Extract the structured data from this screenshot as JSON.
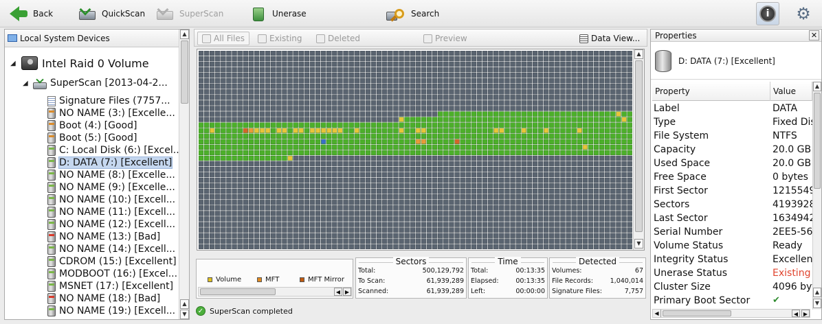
{
  "toolbar": {
    "back": "Back",
    "quickscan": "QuickScan",
    "superscan": "SuperScan",
    "unerase": "Unerase",
    "search": "Search"
  },
  "left_panel": {
    "title": "Local System Devices",
    "device": "Intel   Raid 0 Volume",
    "scan": "SuperScan [2013-04-2...",
    "items": [
      {
        "label": "Signature Files (7757...",
        "kind": "sig",
        "color": "#7ab648"
      },
      {
        "label": "NO NAME (3:) [Excelle...",
        "kind": "vol",
        "color": "#d98b2b"
      },
      {
        "label": "Boot (4:) [Good]",
        "kind": "vol",
        "color": "#d98b2b"
      },
      {
        "label": "Boot (5:) [Good]",
        "kind": "vol",
        "color": "#d98b2b"
      },
      {
        "label": "C: Local Disk (6:) [Excel...",
        "kind": "vol",
        "color": "#7ab648"
      },
      {
        "label": "D: DATA (7:) [Excellent]",
        "kind": "vol",
        "color": "#7ab648",
        "selected": true
      },
      {
        "label": "NO NAME (8:) [Excelle...",
        "kind": "vol",
        "color": "#7ab648"
      },
      {
        "label": "NO NAME (9:) [Excelle...",
        "kind": "vol",
        "color": "#7ab648"
      },
      {
        "label": "NO NAME (10:) [Excell...",
        "kind": "vol",
        "color": "#7ab648"
      },
      {
        "label": "NO NAME (11:) [Excell...",
        "kind": "vol",
        "color": "#7ab648"
      },
      {
        "label": "NO NAME (12:) [Excell...",
        "kind": "vol",
        "color": "#7ab648"
      },
      {
        "label": "NO NAME (13:) [Bad]",
        "kind": "vol",
        "color": "#d93a2b"
      },
      {
        "label": "NO NAME (14:) [Excell...",
        "kind": "vol",
        "color": "#7ab648"
      },
      {
        "label": "CDROM (15:) [Excellent]",
        "kind": "vol",
        "color": "#7ab648"
      },
      {
        "label": "MODBOOT (16:) [Excel...",
        "kind": "vol",
        "color": "#7ab648"
      },
      {
        "label": "MSNET (17:) [Excellent]",
        "kind": "vol",
        "color": "#7ab648"
      },
      {
        "label": "NO NAME (18:) [Bad]",
        "kind": "vol",
        "color": "#d93a2b"
      },
      {
        "label": "NO NAME (19:) [Excell...",
        "kind": "vol",
        "color": "#7ab648"
      }
    ]
  },
  "center": {
    "tabs": {
      "all_files": "All Files",
      "existing": "Existing",
      "deleted": "Deleted",
      "preview": "Preview",
      "data_view": "Data View..."
    },
    "legend": {
      "volume": "Volume",
      "mft": "MFT",
      "mft_mirror": "MFT Mirror",
      "colors": {
        "volume": "#e0c020",
        "mft": "#e08a20",
        "mft_mirror": "#c05a10"
      }
    },
    "grid_colors": {
      "empty": "#5a6470",
      "used": "#4caf2a",
      "volume": "#e8c43a",
      "mft": "#e89a3a",
      "mirror": "#d4642a",
      "special": "#3a6fc8"
    },
    "sectors": {
      "title": "Sectors",
      "total_label": "Total:",
      "total": "500,129,792",
      "toscan_label": "To Scan:",
      "toscan": "61,939,289",
      "scanned_label": "Scanned:",
      "scanned": "61,939,289"
    },
    "time": {
      "title": "Time",
      "total_label": "Total:",
      "total": "00:13:35",
      "elapsed_label": "Elapsed:",
      "elapsed": "00:13:35",
      "left_label": "Left:",
      "left": "00:00:00"
    },
    "detected": {
      "title": "Detected",
      "volumes_label": "Volumes:",
      "volumes": "67",
      "records_label": "File Records:",
      "records": "1,040,014",
      "sig_label": "Signature Files:",
      "sig": "7,757"
    },
    "status": "SuperScan completed"
  },
  "properties": {
    "title": "Properties",
    "summary": "D: DATA (7:) [Excellent]",
    "col_property": "Property",
    "col_value": "Value",
    "rows": [
      {
        "k": "Label",
        "v": "DATA"
      },
      {
        "k": "Type",
        "v": "Fixed Dis"
      },
      {
        "k": "File System",
        "v": "NTFS"
      },
      {
        "k": "Capacity",
        "v": "20.0 GB"
      },
      {
        "k": "Used Space",
        "v": "20.0 GB"
      },
      {
        "k": "Free Space",
        "v": "0 bytes"
      },
      {
        "k": "First Sector",
        "v": "1215549"
      },
      {
        "k": "Sectors",
        "v": "4193928"
      },
      {
        "k": "Last Sector",
        "v": "1634942"
      },
      {
        "k": "Serial Number",
        "v": "2EE5-56"
      },
      {
        "k": "Volume Status",
        "v": "Ready"
      },
      {
        "k": "Integrity Status",
        "v": "Excellent"
      },
      {
        "k": "Unerase Status",
        "v": "Existing",
        "red": true
      },
      {
        "k": "Cluster Size",
        "v": "4096 byt"
      },
      {
        "k": "Primary Boot Sector",
        "v": "✔",
        "check": true
      }
    ]
  }
}
